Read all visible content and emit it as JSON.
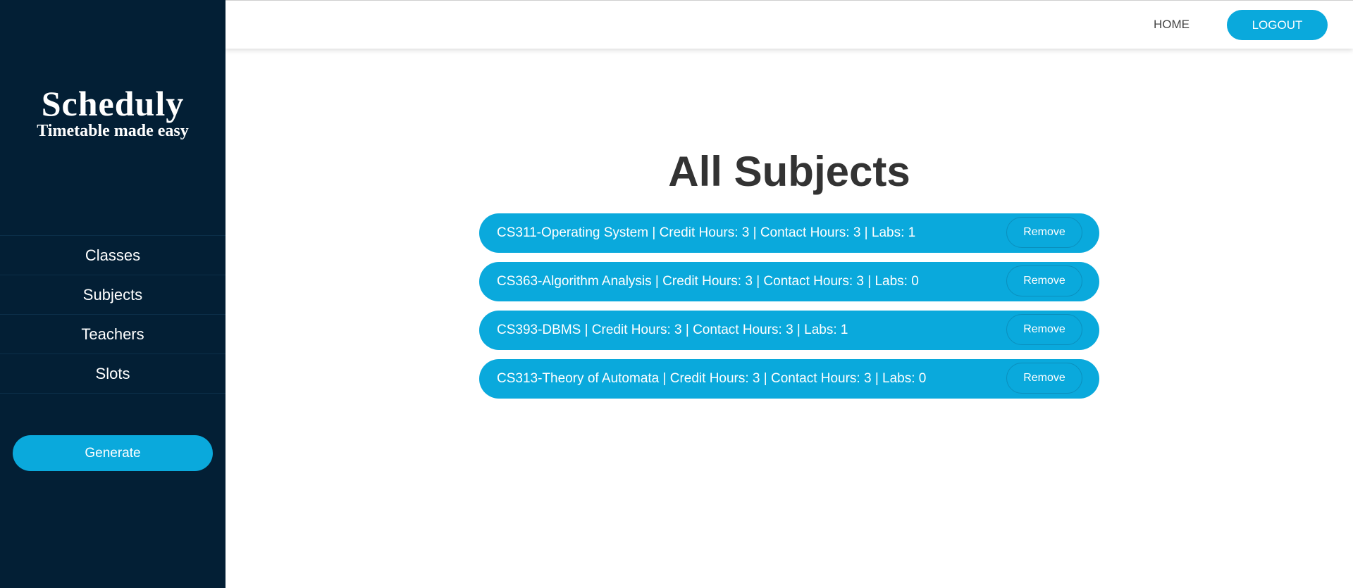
{
  "brand": {
    "name": "Scheduly",
    "tagline": "Timetable made easy"
  },
  "sidebar": {
    "items": [
      {
        "label": "Classes"
      },
      {
        "label": "Subjects"
      },
      {
        "label": "Teachers"
      },
      {
        "label": "Slots"
      }
    ],
    "generate_label": "Generate"
  },
  "header": {
    "home_label": "HOME",
    "logout_label": "LOGOUT"
  },
  "main": {
    "title": "All Subjects",
    "subjects": [
      {
        "text": "CS311-Operating System | Credit Hours: 3 | Contact Hours: 3 | Labs: 1",
        "action_label": "Remove"
      },
      {
        "text": "CS363-Algorithm Analysis | Credit Hours: 3 | Contact Hours: 3 | Labs: 0",
        "action_label": "Remove"
      },
      {
        "text": "CS393-DBMS | Credit Hours: 3 | Contact Hours: 3 | Labs: 1",
        "action_label": "Remove"
      },
      {
        "text": "CS313-Theory of Automata | Credit Hours: 3 | Contact Hours: 3 | Labs: 0",
        "action_label": "Remove"
      }
    ]
  },
  "colors": {
    "sidebar_bg": "#031f35",
    "accent": "#0aa9dc",
    "title_text": "#333333"
  }
}
